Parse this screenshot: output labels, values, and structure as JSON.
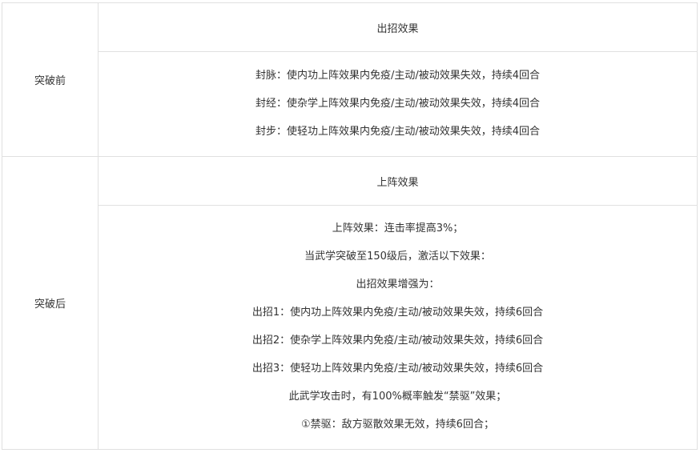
{
  "rows": [
    {
      "label": "突破前",
      "header": "出招效果",
      "lines": [
        "封脉：使内功上阵效果内免疫/主动/被动效果失效，持续4回合",
        "封经：使杂学上阵效果内免疫/主动/被动效果失效，持续4回合",
        "封步：使轻功上阵效果内免疫/主动/被动效果失效，持续4回合"
      ]
    },
    {
      "label": "突破后",
      "header": "上阵效果",
      "lines": [
        "上阵效果：连击率提高3%；",
        "当武学突破至150级后，激活以下效果：",
        "出招效果增强为：",
        "出招1：使内功上阵效果内免疫/主动/被动效果失效，持续6回合",
        "出招2：使杂学上阵效果内免疫/主动/被动效果失效，持续6回合",
        "出招3：使轻功上阵效果内免疫/主动/被动效果失效，持续6回合",
        "此武学攻击时，有100%概率触发“禁驱”效果；",
        "①禁驱：敌方驱散效果无效，持续6回合；"
      ]
    }
  ]
}
